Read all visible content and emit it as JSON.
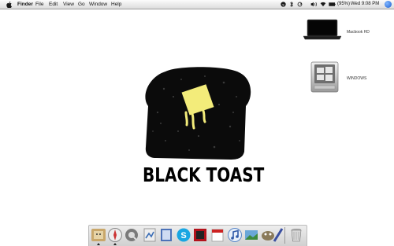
{
  "menubar": {
    "app_name": "Finder",
    "items": [
      "File",
      "Edit",
      "View",
      "Go",
      "Window",
      "Help"
    ],
    "battery": "(95%)",
    "clock": "Wed 9:08 PM"
  },
  "desktop": {
    "icons": [
      {
        "label": "Macbook HD",
        "icon": "laptop-icon"
      },
      {
        "label": "WINDOWS",
        "icon": "hard-drive-icon"
      }
    ]
  },
  "wallpaper": {
    "logo_text": "BLACK TOAST",
    "colors": {
      "toast": "#0a0a0a",
      "butter": "#f3ec7a"
    }
  },
  "dock": {
    "items": [
      "finder-icon",
      "safari-icon",
      "quicktime-icon",
      "preview-icon",
      "address-book-icon",
      "skype-icon",
      "photo-booth-icon",
      "ical-icon",
      "itunes-icon",
      "iphoto-icon",
      "gimp-icon",
      "system-preferences-icon",
      "app-icon",
      "trash-icon"
    ]
  }
}
